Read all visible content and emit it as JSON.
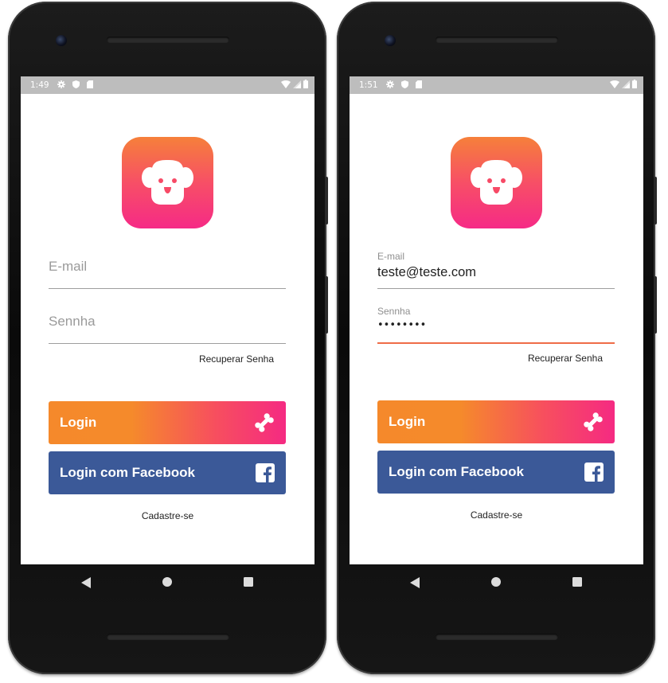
{
  "left": {
    "status_time": "1:49",
    "email_placeholder": "E-mail",
    "password_placeholder": "Sennha",
    "recover_label": "Recuperar Senha",
    "login_label": "Login",
    "facebook_label": "Login com Facebook",
    "signup_label": "Cadastre-se"
  },
  "right": {
    "status_time": "1:51",
    "email_label": "E-mail",
    "email_value": "teste@teste.com",
    "password_label": "Sennha",
    "password_masked": "••••••••",
    "recover_label": "Recuperar Senha",
    "login_label": "Login",
    "facebook_label": "Login com Facebook",
    "signup_label": "Cadastre-se"
  },
  "icons": {
    "logo": "dog-face-icon",
    "login": "bone-icon",
    "facebook": "facebook-icon",
    "status": [
      "settings-icon",
      "shield-icon",
      "sd-card-icon",
      "wifi-icon",
      "signal-icon",
      "battery-icon"
    ],
    "nav": [
      "back-icon",
      "home-icon",
      "recents-icon"
    ]
  },
  "colors": {
    "gradient_start": "#f5892b",
    "gradient_end": "#f52a82",
    "facebook_blue": "#3b5998",
    "focus_underline": "#ef6c47"
  }
}
